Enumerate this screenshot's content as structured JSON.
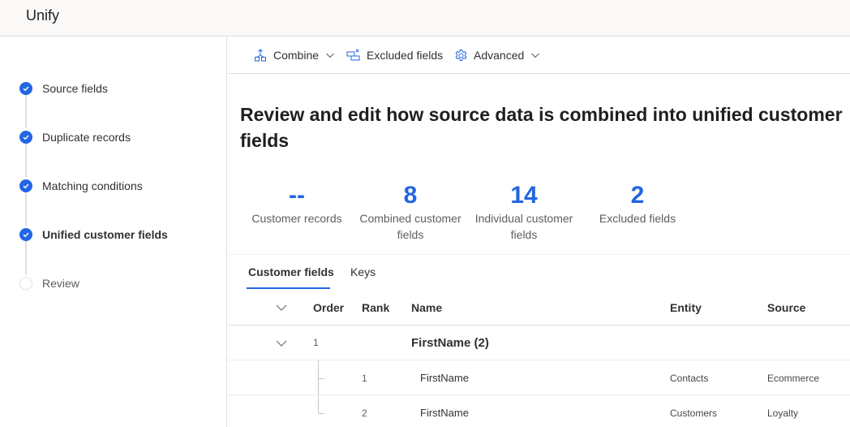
{
  "app": {
    "title": "Unify"
  },
  "steps": [
    {
      "label": "Source fields",
      "status": "complete"
    },
    {
      "label": "Duplicate records",
      "status": "complete"
    },
    {
      "label": "Matching conditions",
      "status": "complete"
    },
    {
      "label": "Unified customer fields",
      "status": "current"
    },
    {
      "label": "Review",
      "status": "pending"
    }
  ],
  "toolbar": {
    "combine_label": "Combine",
    "combine_icon": "combine-icon",
    "excluded_label": "Excluded fields",
    "excluded_icon": "excluded-fields-icon",
    "advanced_label": "Advanced",
    "advanced_icon": "gear-icon"
  },
  "page": {
    "title": "Review and edit how source data is combined into unified customer fields"
  },
  "stats": [
    {
      "value": "--",
      "label": "Customer records"
    },
    {
      "value": "8",
      "label": "Combined customer fields"
    },
    {
      "value": "14",
      "label": "Individual customer fields"
    },
    {
      "value": "2",
      "label": "Excluded fields"
    }
  ],
  "tabs": [
    {
      "label": "Customer fields",
      "active": true
    },
    {
      "label": "Keys",
      "active": false
    }
  ],
  "table": {
    "columns": {
      "order": "Order",
      "rank": "Rank",
      "name": "Name",
      "entity": "Entity",
      "source": "Source"
    },
    "groups": [
      {
        "order": "1",
        "name": "FirstName (2)",
        "rows": [
          {
            "rank": "1",
            "name": "FirstName",
            "entity": "Contacts",
            "source": "Ecommerce"
          },
          {
            "rank": "2",
            "name": "FirstName",
            "entity": "Customers",
            "source": "Loyalty"
          }
        ]
      }
    ]
  },
  "colors": {
    "accent": "#2266e3",
    "border": "#e1dfdd",
    "topbar": "#faf9f8"
  }
}
